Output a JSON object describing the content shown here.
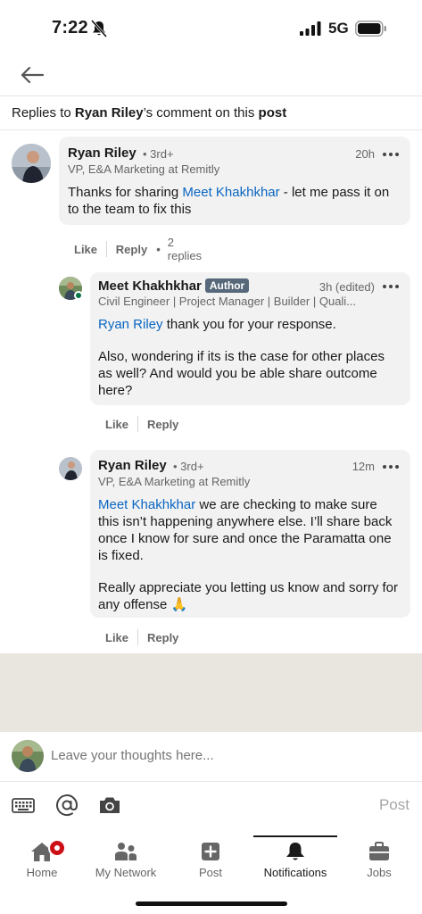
{
  "status_bar": {
    "time": "7:22",
    "network": "5G"
  },
  "header": {
    "replies_prefix": "Replies to ",
    "replies_name": "Ryan Riley",
    "replies_middle": "’s comment on this ",
    "replies_post": "post"
  },
  "comments": [
    {
      "name": "Ryan Riley",
      "degree": "• 3rd+",
      "time": "20h",
      "headline": "VP, E&A Marketing at Remitly",
      "mention": "Meet Khakhkhar",
      "body_before": "Thanks for sharing ",
      "body_after": " - let me pass it on to the team to fix this",
      "like": "Like",
      "reply": "Reply",
      "replies": "2 replies"
    },
    {
      "name": "Meet Khakhkhar",
      "badge": "Author",
      "time": "3h (edited)",
      "headline": "Civil Engineer | Project Manager | Builder | Quali...",
      "mention": "Ryan Riley",
      "body_after": " thank you for your response.",
      "body_p2": "Also, wondering if its is the case for other places as well? And would you be able share outcome here?",
      "like": "Like",
      "reply": "Reply"
    },
    {
      "name": "Ryan Riley",
      "degree": "• 3rd+",
      "time": "12m",
      "headline": "VP, E&A Marketing at Remitly",
      "mention": "Meet Khakhkhar",
      "body_after": " we are checking to make sure this isn’t happening anywhere else. I’ll share back once I know for sure and once the Paramatta one is fixed.",
      "body_p2": "Really appreciate you letting us know and sorry for any offense 🙏",
      "like": "Like",
      "reply": "Reply"
    }
  ],
  "compose": {
    "placeholder": "Leave your thoughts here...",
    "post_label": "Post"
  },
  "bottom_nav": [
    {
      "label": "Home",
      "icon": "home-icon"
    },
    {
      "label": "My Network",
      "icon": "my-network-icon"
    },
    {
      "label": "Post",
      "icon": "post-icon"
    },
    {
      "label": "Notifications",
      "icon": "notifications-icon",
      "active": true
    },
    {
      "label": "Jobs",
      "icon": "jobs-icon"
    }
  ],
  "colors": {
    "link": "#0a66c2",
    "bubble": "#f2f2f2",
    "band": "#e9e5df",
    "badge": "#56687a",
    "notification_red": "#cc1016"
  }
}
